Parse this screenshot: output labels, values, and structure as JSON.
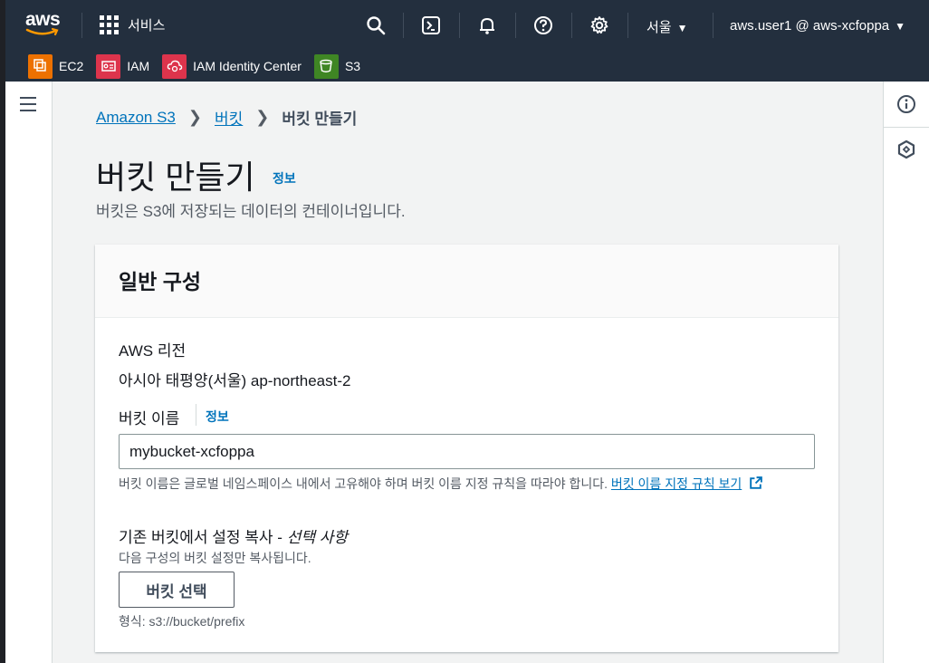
{
  "nav": {
    "logo_text": "aws",
    "services_label": "서비스",
    "region_label": "서울",
    "account_label": "aws.user1 @ aws-xcfoppa",
    "icons": [
      "search-icon",
      "cloudshell-icon",
      "bell-icon",
      "help-icon",
      "gear-icon"
    ]
  },
  "favorites": [
    {
      "label": "EC2",
      "color": "#ed7100"
    },
    {
      "label": "IAM",
      "color": "#dd344c"
    },
    {
      "label": "IAM Identity Center",
      "color": "#dd344c"
    },
    {
      "label": "S3",
      "color": "#3f8624"
    }
  ],
  "breadcrumb": {
    "items": [
      "Amazon S3",
      "버킷"
    ],
    "current": "버킷 만들기"
  },
  "page": {
    "title": "버킷 만들기",
    "info": "정보",
    "description": "버킷은 S3에 저장되는 데이터의 컨테이너입니다."
  },
  "general": {
    "title": "일반 구성",
    "region_label": "AWS 리전",
    "region_value": "아시아 태평양(서울) ap-northeast-2",
    "bucket_name_label": "버킷 이름",
    "bucket_name_info": "정보",
    "bucket_name_value": "mybucket-xcfoppa",
    "bucket_name_hint": "버킷 이름은 글로벌 네임스페이스 내에서 고유해야 하며 버킷 이름 지정 규칙을 따라야 합니다. ",
    "bucket_name_hint_link": "버킷 이름 지정 규칙 보기",
    "copy_label": "기존 버킷에서 설정 복사 - ",
    "copy_optional": "선택 사항",
    "copy_desc": "다음 구성의 버킷 설정만 복사됩니다.",
    "choose_button": "버킷 선택",
    "format_hint": "형식: s3://bucket/prefix"
  },
  "colors": {
    "nav_bg": "#232f3e",
    "link": "#0073bb"
  }
}
